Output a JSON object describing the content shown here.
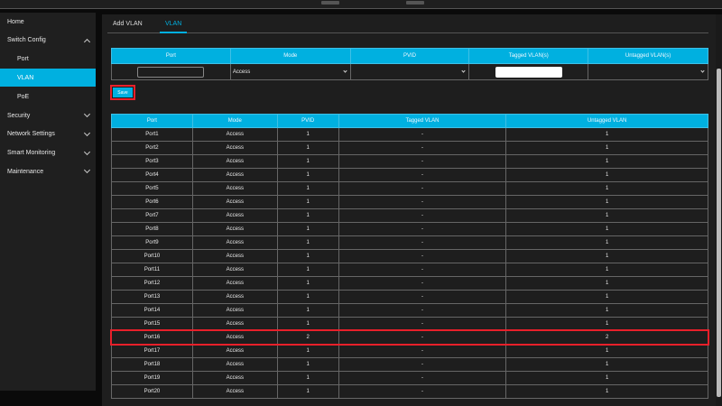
{
  "sidebar": {
    "items": [
      {
        "label": "Home",
        "level": "top",
        "expand": null
      },
      {
        "label": "Switch Config",
        "level": "top",
        "expand": "up"
      },
      {
        "label": "Port",
        "level": "sub",
        "expand": null
      },
      {
        "label": "VLAN",
        "level": "sub",
        "expand": null,
        "active": true
      },
      {
        "label": "PoE",
        "level": "sub",
        "expand": null
      },
      {
        "label": "Security",
        "level": "top",
        "expand": "down"
      },
      {
        "label": "Network Settings",
        "level": "top",
        "expand": "down"
      },
      {
        "label": "Smart Monitoring",
        "level": "top",
        "expand": "down"
      },
      {
        "label": "Maintenance",
        "level": "top",
        "expand": "down"
      }
    ]
  },
  "tabs": [
    {
      "label": "Add VLAN"
    },
    {
      "label": "VLAN",
      "active": true
    }
  ],
  "form": {
    "headers": [
      "Port",
      "Mode",
      "PVID",
      "Tagged VLAN(s)",
      "Untagged VLAN(s)"
    ],
    "port_value": "",
    "mode_value": "Access",
    "pvid_value": "",
    "tagged_value": "",
    "untagged_value": ""
  },
  "save_label": "Save",
  "vlan_table": {
    "headers": [
      "Port",
      "Mode",
      "PVID",
      "Tagged VLAN",
      "Untagged VLAN"
    ],
    "rows": [
      [
        "Port1",
        "Access",
        "1",
        "-",
        "1"
      ],
      [
        "Port2",
        "Access",
        "1",
        "-",
        "1"
      ],
      [
        "Port3",
        "Access",
        "1",
        "-",
        "1"
      ],
      [
        "Port4",
        "Access",
        "1",
        "-",
        "1"
      ],
      [
        "Port5",
        "Access",
        "1",
        "-",
        "1"
      ],
      [
        "Port6",
        "Access",
        "1",
        "-",
        "1"
      ],
      [
        "Port7",
        "Access",
        "1",
        "-",
        "1"
      ],
      [
        "Port8",
        "Access",
        "1",
        "-",
        "1"
      ],
      [
        "Port9",
        "Access",
        "1",
        "-",
        "1"
      ],
      [
        "Port10",
        "Access",
        "1",
        "-",
        "1"
      ],
      [
        "Port11",
        "Access",
        "1",
        "-",
        "1"
      ],
      [
        "Port12",
        "Access",
        "1",
        "-",
        "1"
      ],
      [
        "Port13",
        "Access",
        "1",
        "-",
        "1"
      ],
      [
        "Port14",
        "Access",
        "1",
        "-",
        "1"
      ],
      [
        "Port15",
        "Access",
        "1",
        "-",
        "1"
      ],
      [
        "Port16",
        "Access",
        "2",
        "-",
        "2"
      ],
      [
        "Port17",
        "Access",
        "1",
        "-",
        "1"
      ],
      [
        "Port18",
        "Access",
        "1",
        "-",
        "1"
      ],
      [
        "Port19",
        "Access",
        "1",
        "-",
        "1"
      ],
      [
        "Port20",
        "Access",
        "1",
        "-",
        "1"
      ]
    ],
    "highlighted_row": "Port16"
  },
  "colors": {
    "accent": "#00b0e0",
    "highlight": "#e8202a",
    "background": "#1e1e1e"
  }
}
